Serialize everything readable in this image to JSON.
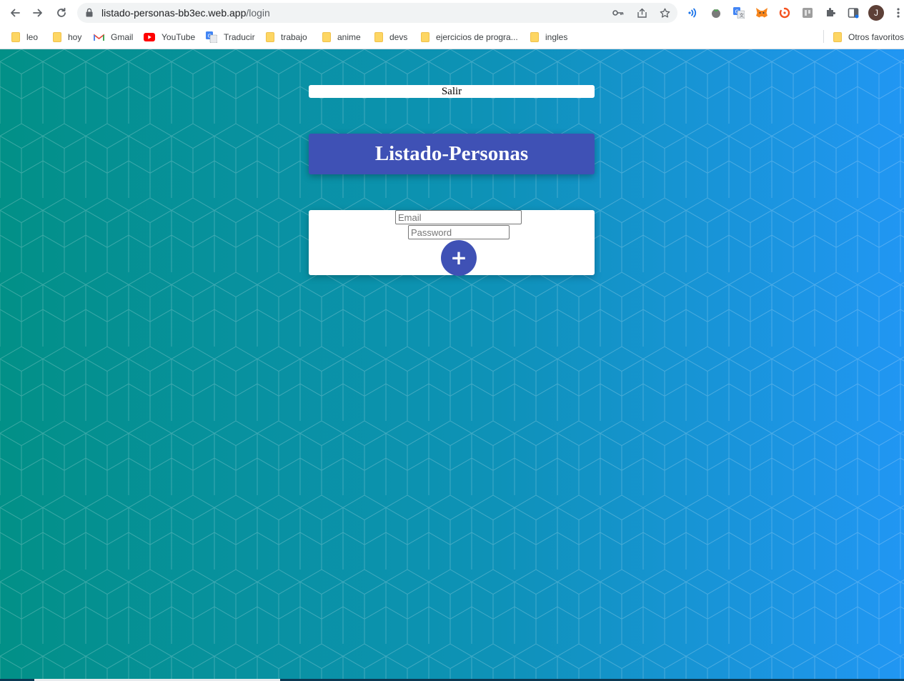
{
  "browser": {
    "url_host": "listado-personas-bb3ec.web.app",
    "url_path": "/login",
    "profile_initial": "J"
  },
  "bookmarks": [
    {
      "label": "leo",
      "icon": "folder-icon"
    },
    {
      "label": "hoy",
      "icon": "folder-icon"
    },
    {
      "label": "Gmail",
      "icon": "gmail-icon"
    },
    {
      "label": "YouTube",
      "icon": "youtube-icon"
    },
    {
      "label": "Traducir",
      "icon": "translate-icon"
    },
    {
      "label": "trabajo",
      "icon": "folder-icon"
    },
    {
      "label": "anime",
      "icon": "folder-icon"
    },
    {
      "label": "devs",
      "icon": "folder-icon"
    },
    {
      "label": "ejercicios de progra...",
      "icon": "folder-icon"
    },
    {
      "label": "ingles",
      "icon": "folder-icon"
    }
  ],
  "other_bookmarks": "Otros favoritos",
  "app": {
    "logout_label": "Salir",
    "title": "Listado-Personas",
    "email_placeholder": "Email",
    "password_placeholder": "Password",
    "submit_label": "+",
    "primary_color": "#3f51b5"
  }
}
